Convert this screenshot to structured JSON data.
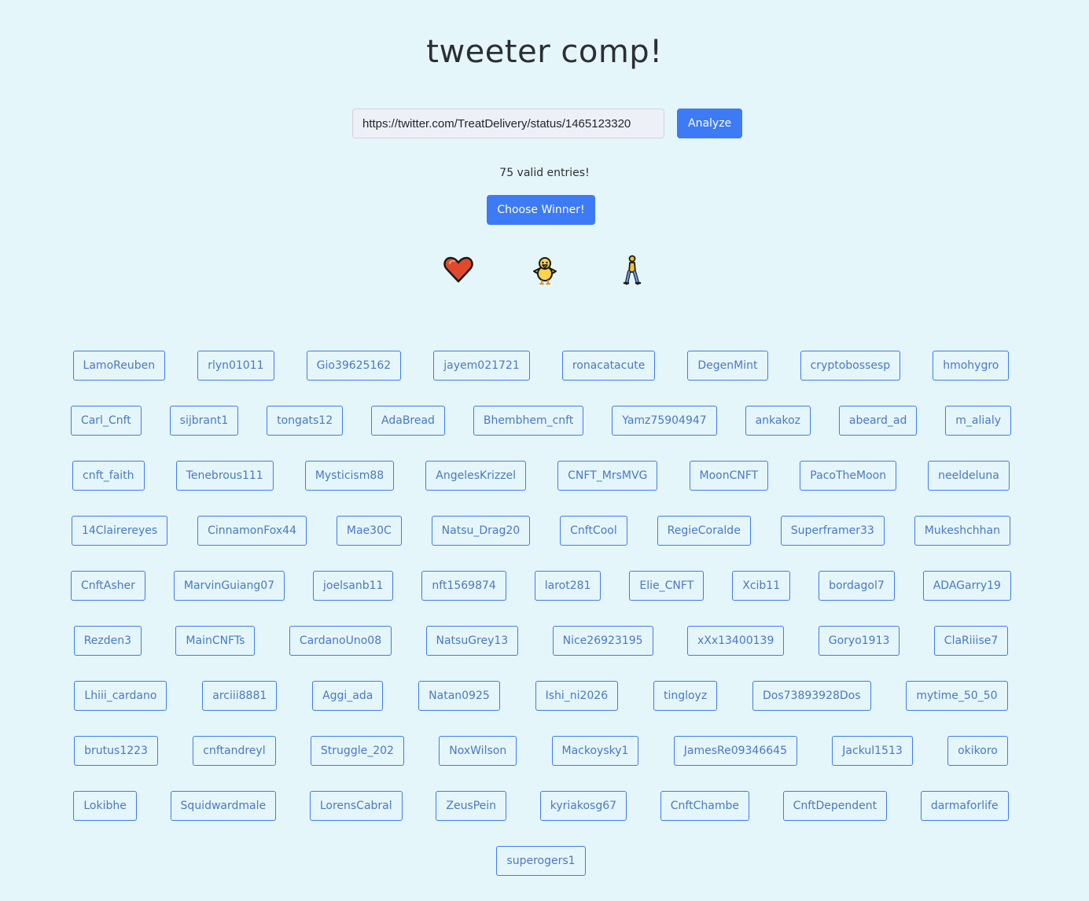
{
  "title": "tweeter comp!",
  "url_input": {
    "value": "https://twitter.com/TreatDelivery/status/1465123320"
  },
  "analyze_label": "Analyze",
  "entries_text": "75 valid entries!",
  "choose_winner_label": "Choose Winner!",
  "emojis": [
    "heart-icon",
    "chick-icon",
    "walking-person-icon"
  ],
  "colors": {
    "background": "#e5f6fa",
    "accent": "#3d7af5",
    "chip_text": "#4a78c8"
  },
  "entry_rows": [
    [
      "LamoReuben",
      "rlyn01011",
      "Gio39625162",
      "jayem021721",
      "ronacatacute",
      "DegenMint",
      "cryptobossesp",
      "hmohygro"
    ],
    [
      "Carl_Cnft",
      "sijbrant1",
      "tongats12",
      "AdaBread",
      "Bhembhem_cnft",
      "Yamz75904947",
      "ankakoz",
      "abeard_ad",
      "m_alialy"
    ],
    [
      "cnft_faith",
      "Tenebrous111",
      "Mysticism88",
      "AngelesKrizzel",
      "CNFT_MrsMVG",
      "MoonCNFT",
      "PacoTheMoon",
      "neeldeluna"
    ],
    [
      "14Clairereyes",
      "CinnamonFox44",
      "Mae30C",
      "Natsu_Drag20",
      "CnftCool",
      "RegieCoralde",
      "Superframer33",
      "Mukeshchhan"
    ],
    [
      "CnftAsher",
      "MarvinGuiang07",
      "joelsanb11",
      "nft1569874",
      "larot281",
      "Elie_CNFT",
      "Xcib11",
      "bordagol7",
      "ADAGarry19"
    ],
    [
      "Rezden3",
      "MainCNFTs",
      "CardanoUno08",
      "NatsuGrey13",
      "Nice26923195",
      "xXx13400139",
      "Goryo1913",
      "ClaRiiise7"
    ],
    [
      "Lhiii_cardano",
      "arciii8881",
      "Aggi_ada",
      "Natan0925",
      "Ishi_ni2026",
      "tingloyz",
      "Dos73893928Dos",
      "mytime_50_50"
    ],
    [
      "brutus1223",
      "cnftandreyl",
      "Struggle_202",
      "NoxWilson",
      "Mackoysky1",
      "JamesRe09346645",
      "Jackul1513",
      "okikoro"
    ],
    [
      "Lokibhe",
      "Squidwardmale",
      "LorensCabral",
      "ZeusPein",
      "kyriakosg67",
      "CnftChambe",
      "CnftDependent",
      "darmaforlife"
    ],
    [
      "superogers1"
    ]
  ]
}
